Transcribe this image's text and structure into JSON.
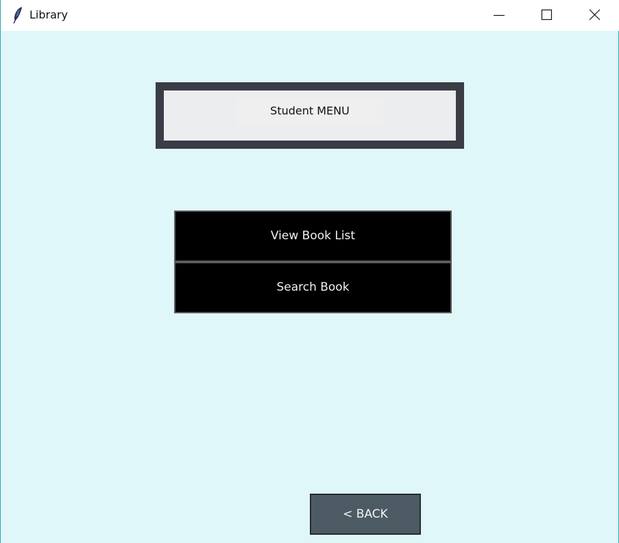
{
  "window": {
    "title": "Library",
    "icon": "feather-icon",
    "background_color": "#dff7f9",
    "controls": [
      "minimize-icon",
      "maximize-icon",
      "close-icon"
    ]
  },
  "header": {
    "label": "Student MENU",
    "frame_color": "#3a3d46",
    "background_color": "#ebedee"
  },
  "menu": {
    "buttons": [
      {
        "label": "View Book List",
        "background_color": "#000000",
        "text_color": "#f0f0f0"
      },
      {
        "label": "Search Book",
        "background_color": "#000000",
        "text_color": "#f0f0f0"
      }
    ]
  },
  "footer": {
    "back_label": "<  BACK",
    "back_color": "#4c5b63"
  }
}
